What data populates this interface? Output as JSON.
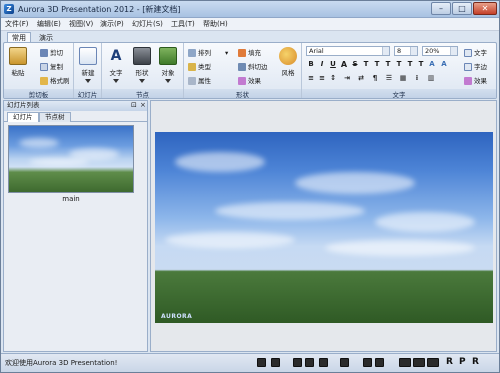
{
  "window": {
    "title": "Aurora 3D Presentation 2012 - [新建文档]",
    "controls": {
      "minimize": "–",
      "maximize": "□",
      "close": "✕"
    }
  },
  "menubar": {
    "items": [
      "文件(F)",
      "编辑(E)",
      "视图(V)",
      "演示(P)",
      "幻灯片(S)",
      "工具(T)",
      "帮助(H)"
    ]
  },
  "ribbon": {
    "tabs": [
      "常用",
      "演示"
    ],
    "active_tab": "常用",
    "groups": {
      "clipboard": {
        "label": "剪切板",
        "paste": "粘贴",
        "cut": "剪切",
        "copy": "复制",
        "format_painter": "格式刷"
      },
      "slides": {
        "label": "幻灯片",
        "new": "新建"
      },
      "nodes": {
        "label": "节点",
        "text": "文字",
        "shape": "形状",
        "object": "对象"
      },
      "shape": {
        "label": "形状",
        "arrange": "排列",
        "type": "类型",
        "attribute": "属性",
        "fill": "填充",
        "bevel": "斜切边",
        "effect": "效果",
        "style": "风格"
      },
      "text": {
        "label": "文字",
        "font": "Arial",
        "size": "8",
        "zoom": "20%",
        "text_btn": "文字",
        "char_spacing": "字边",
        "effect": "效果"
      }
    }
  },
  "left_panel": {
    "title": "幻灯片列表",
    "tabs": [
      "幻灯片",
      "节点树"
    ],
    "active_tab": "幻灯片",
    "slides": [
      {
        "name": "main"
      }
    ]
  },
  "stage": {
    "logo": "AURORA"
  },
  "statusbar": {
    "message": "欢迎使用Aurora 3D Presentation!",
    "letters": [
      "R",
      "P",
      "R"
    ]
  },
  "colors": {
    "accent": "#9aaec9",
    "title_bar": "#a8c2e2",
    "sky": "#4d84d6",
    "grass": "#2f5a25"
  }
}
